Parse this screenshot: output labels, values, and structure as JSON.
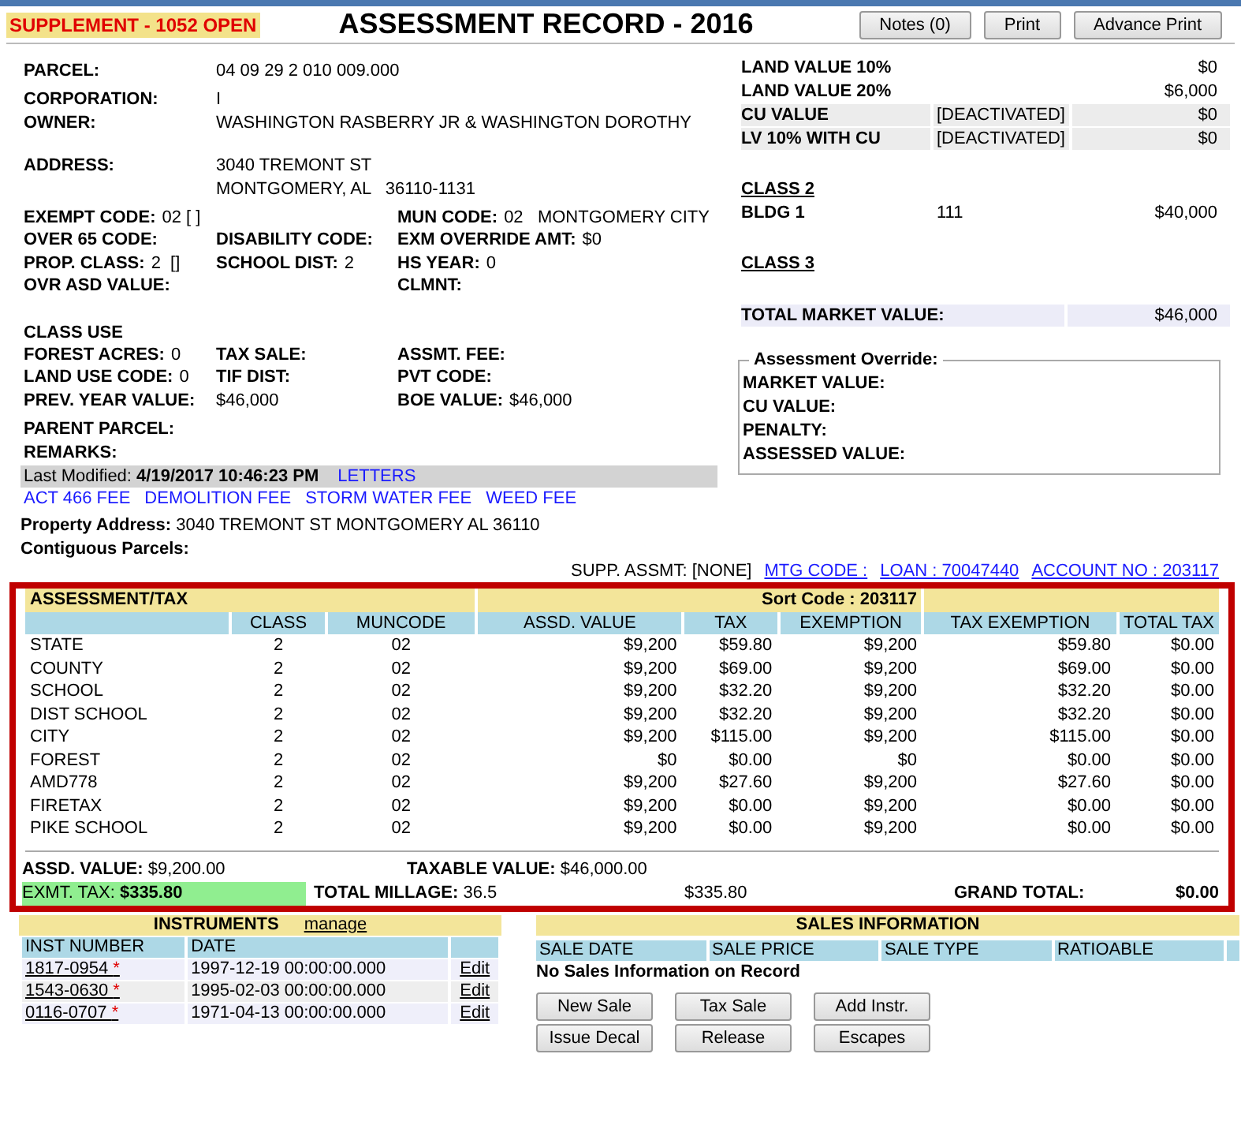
{
  "header": {
    "badge": "SUPPLEMENT - 1052  OPEN",
    "title": "ASSESSMENT RECORD - 2016",
    "buttons": [
      "Notes (0)",
      "Print",
      "Advance Print"
    ]
  },
  "identity": [
    {
      "label": "PARCEL:",
      "lines": [
        "04 09 29 2 010 009.000"
      ]
    },
    {
      "label": "CORPORATION:",
      "lines": [
        "I"
      ]
    },
    {
      "label": "OWNER:",
      "lines": [
        "WASHINGTON RASBERRY JR & WASHINGTON DOROTHY"
      ]
    },
    {
      "label": "ADDRESS:",
      "lines": [
        "3040 TREMONT ST",
        "MONTGOMERY, AL   36110-1131"
      ]
    }
  ],
  "codes": [
    {
      "left": {
        "label": "EXEMPT CODE:",
        "value": "02 [ ]"
      },
      "right": {
        "label": "MUN CODE:",
        "value": "02   MONTGOMERY CITY"
      }
    },
    {
      "left": {
        "label": "OVER 65 CODE:"
      },
      "middle": {
        "label": "DISABILITY CODE:"
      },
      "right": {
        "label": "EXM OVERRIDE AMT:",
        "value": "$0"
      }
    },
    {
      "left": {
        "label": "PROP. CLASS:",
        "value": "2  []"
      },
      "middle": {
        "label": "SCHOOL DIST:",
        "value": "2"
      },
      "right": {
        "label": "HS YEAR:",
        "value": "0"
      }
    },
    {
      "left": {
        "label": "OVR ASD VALUE:"
      },
      "right": {
        "label": "CLMNT:"
      }
    }
  ],
  "class_use": {
    "title": "CLASS USE",
    "rows": [
      [
        {
          "label": "FOREST ACRES:",
          "value": "0"
        },
        {
          "label": "TAX SALE:"
        },
        {
          "label": "ASSMT. FEE:"
        }
      ],
      [
        {
          "label": "LAND USE CODE:",
          "value": "0"
        },
        {
          "label": "TIF DIST:"
        },
        {
          "label": "PVT CODE:"
        }
      ],
      [
        {
          "label": "PREV. YEAR VALUE:"
        },
        {
          "value": "$46,000"
        },
        {
          "label": "BOE VALUE:",
          "value": "$46,000"
        }
      ]
    ]
  },
  "parent_labels": [
    "PARENT PARCEL:",
    "REMARKS:"
  ],
  "last_modified": {
    "label": "Last Modified:",
    "value": "4/19/2017 10:46:23 PM",
    "link": "LETTERS"
  },
  "fee_links": [
    "ACT 466 FEE",
    "DEMOLITION FEE",
    "STORM WATER FEE",
    "WEED FEE"
  ],
  "property_address": {
    "label": "Property Address:",
    "value": "3040 TREMONT ST  MONTGOMERY AL 36110"
  },
  "contiguous_label": "Contiguous Parcels:",
  "land": [
    {
      "label": "LAND VALUE 10%",
      "value": "$0"
    },
    {
      "label": "LAND VALUE 20%",
      "value": "$6,000"
    },
    {
      "label": "CU VALUE",
      "note": "[DEACTIVATED]",
      "value": "$0"
    },
    {
      "label": "LV 10% WITH CU",
      "note": "[DEACTIVATED]",
      "value": "$0"
    }
  ],
  "class2": {
    "heading": "CLASS 2",
    "rows": [
      {
        "label": "BLDG 1",
        "code": "111",
        "value": "$40,000"
      }
    ]
  },
  "class3": {
    "heading": "CLASS 3"
  },
  "total_market": {
    "label": "TOTAL MARKET VALUE:",
    "value": "$46,000"
  },
  "override": {
    "legend": "Assessment Override:",
    "fields": [
      "MARKET VALUE:",
      "CU VALUE:",
      "PENALTY:",
      "ASSESSED VALUE:"
    ]
  },
  "supp_line": {
    "text": "SUPP. ASSMT: [NONE]",
    "links": [
      "MTG CODE :",
      "LOAN : 70047440",
      "ACCOUNT NO : 203117"
    ]
  },
  "tax": {
    "title": "ASSESSMENT/TAX",
    "sort_code": "Sort Code : 203117",
    "columns": [
      "",
      "CLASS",
      "MUNCODE",
      "ASSD. VALUE",
      "TAX",
      "EXEMPTION",
      "TAX EXEMPTION",
      "TOTAL TAX"
    ],
    "rows": [
      [
        "STATE",
        "2",
        "02",
        "$9,200",
        "$59.80",
        "$9,200",
        "$59.80",
        "$0.00"
      ],
      [
        "COUNTY",
        "2",
        "02",
        "$9,200",
        "$69.00",
        "$9,200",
        "$69.00",
        "$0.00"
      ],
      [
        "SCHOOL",
        "2",
        "02",
        "$9,200",
        "$32.20",
        "$9,200",
        "$32.20",
        "$0.00"
      ],
      [
        "DIST SCHOOL",
        "2",
        "02",
        "$9,200",
        "$32.20",
        "$9,200",
        "$32.20",
        "$0.00"
      ],
      [
        "CITY",
        "2",
        "02",
        "$9,200",
        "$115.00",
        "$9,200",
        "$115.00",
        "$0.00"
      ],
      [
        "FOREST",
        "2",
        "02",
        "$0",
        "$0.00",
        "$0",
        "$0.00",
        "$0.00"
      ],
      [
        "AMD778",
        "2",
        "02",
        "$9,200",
        "$27.60",
        "$9,200",
        "$27.60",
        "$0.00"
      ],
      [
        "FIRETAX",
        "2",
        "02",
        "$9,200",
        "$0.00",
        "$9,200",
        "$0.00",
        "$0.00"
      ],
      [
        "PIKE SCHOOL",
        "2",
        "02",
        "$9,200",
        "$0.00",
        "$9,200",
        "$0.00",
        "$0.00"
      ]
    ],
    "summary": {
      "assd_label": "ASSD. VALUE:",
      "assd_value": "$9,200.00",
      "taxable_label": "TAXABLE VALUE:",
      "taxable_value": "$46,000.00",
      "exmt_label": "EXMT. TAX:",
      "exmt_value": "$335.80",
      "millage_label": "TOTAL MILLAGE:",
      "millage_value": "36.5",
      "millage_total": "$335.80",
      "grand_label": "GRAND TOTAL:",
      "grand_value": "$0.00"
    }
  },
  "instruments": {
    "title": "INSTRUMENTS",
    "link": "manage",
    "columns": [
      "INST NUMBER",
      "DATE"
    ],
    "rows": [
      {
        "number": "1817-0954",
        "flag": "*",
        "date": "1997-12-19 00:00:00.000",
        "action": "Edit"
      },
      {
        "number": "1543-0630",
        "flag": "*",
        "date": "1995-02-03 00:00:00.000",
        "action": "Edit"
      },
      {
        "number": "0116-0707",
        "flag": "*",
        "date": "1971-04-13 00:00:00.000",
        "action": "Edit"
      }
    ]
  },
  "sales": {
    "title": "SALES INFORMATION",
    "columns": [
      "SALE DATE",
      "SALE PRICE",
      "SALE TYPE",
      "RATIOABLE"
    ],
    "message": "No Sales Information on Record"
  },
  "action_buttons": [
    [
      "New Sale",
      "Tax Sale",
      "Add Instr."
    ],
    [
      "Issue Decal",
      "Release",
      "Escapes"
    ]
  ]
}
